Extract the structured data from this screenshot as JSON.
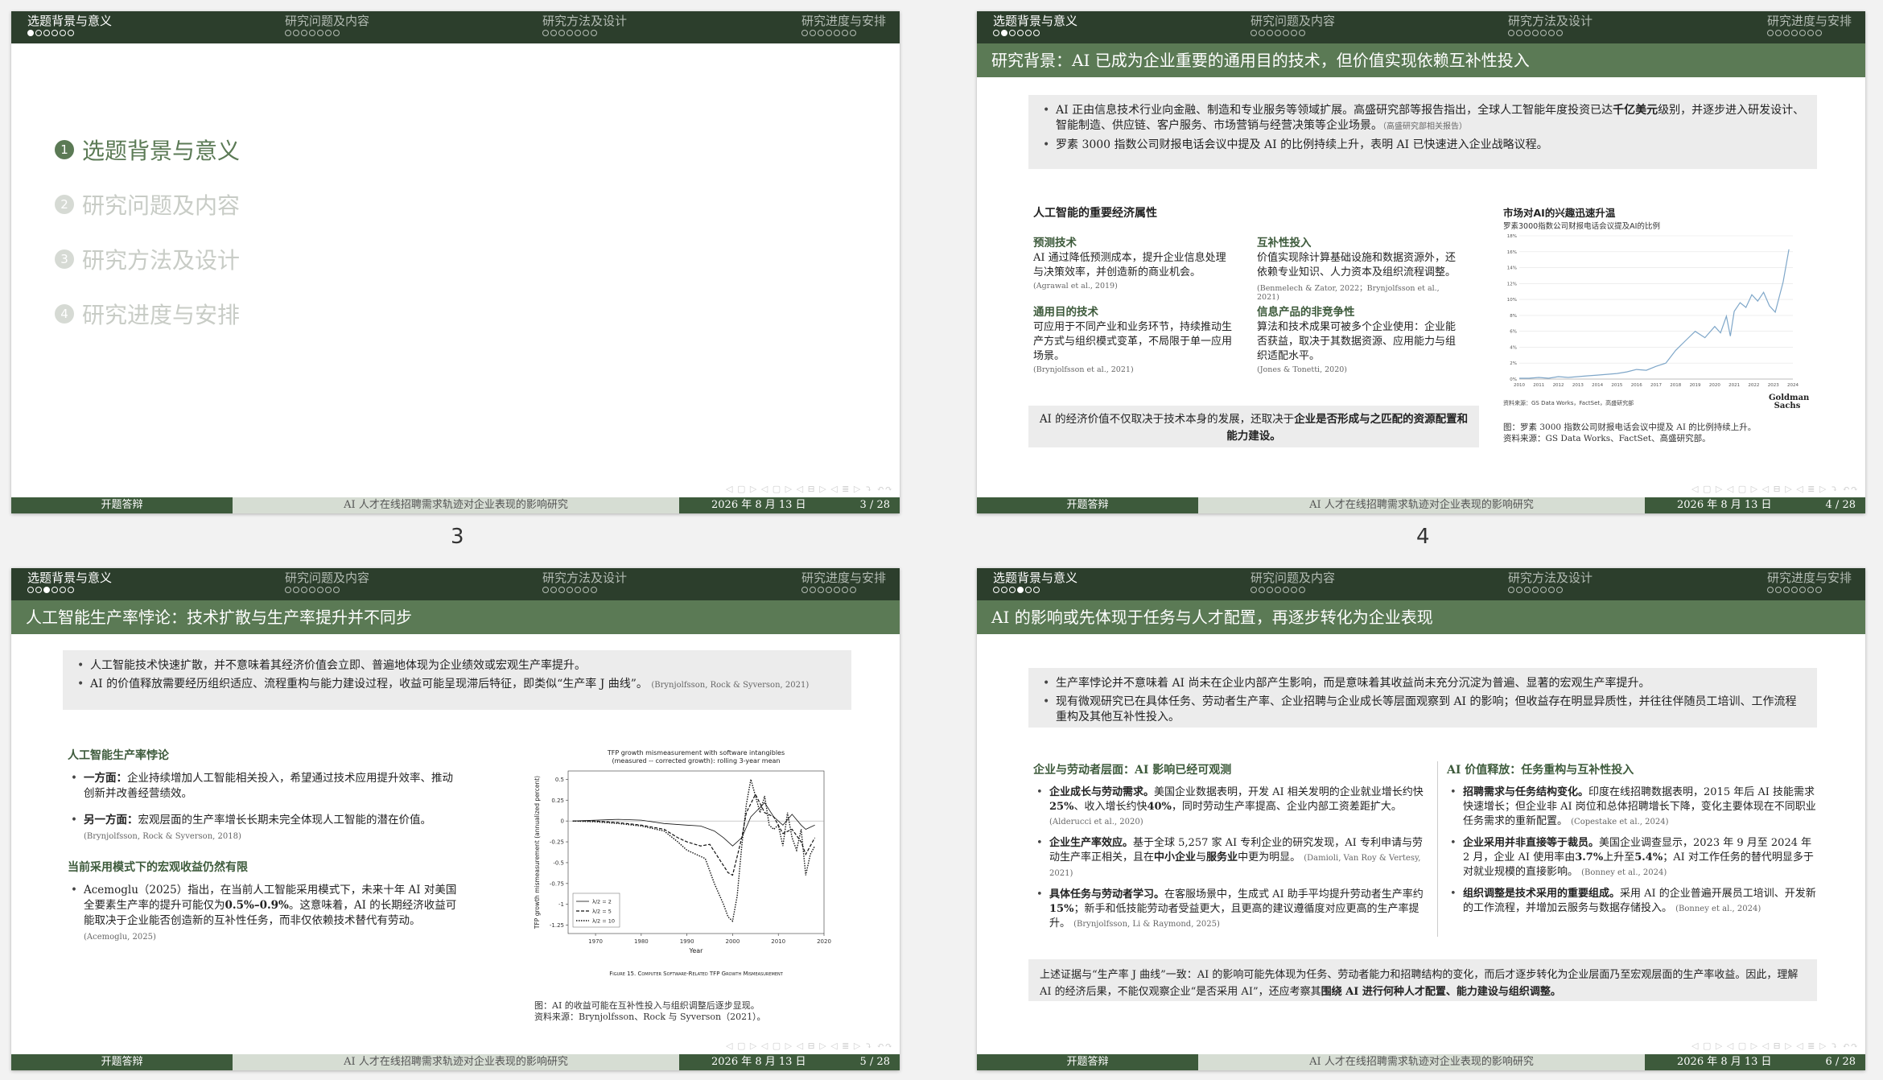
{
  "nav": [
    "选题背景与意义",
    "研究问题及内容",
    "研究方法及设计",
    "研究进度与安排"
  ],
  "footer": {
    "left": "开题答辩",
    "middle": "AI 人才在线招聘需求轨迹对企业表现的影响研究",
    "date": "2026 年 8 月 13 日"
  },
  "navsym": "◁ ▢ ▷  ◁ ▢ ▷  ◁ ⊟ ▷  ◁ ≣ ▷   ⤵   ↶↷",
  "labels": {
    "s3": "3",
    "s4": "4"
  },
  "slide3": {
    "page": "3 / 28",
    "outline": [
      {
        "num": "1",
        "text": "选题背景与意义"
      },
      {
        "num": "2",
        "text": "研究问题及内容"
      },
      {
        "num": "3",
        "text": "研究方法及设计"
      },
      {
        "num": "4",
        "text": "研究进度与安排"
      }
    ]
  },
  "slide4": {
    "page": "4 / 28",
    "title": "研究背景：AI 已成为企业重要的通用目的技术，但价值实现依赖互补性投入",
    "b1a": "AI 正由信息技术行业向金融、制造和专业服务等领域扩展。高盛研究部等报告指出，全球人工智能年度投资已达",
    "b1b": "千亿美元",
    "b1c": "级别，并逐步进入研发设计、智能制造、供应链、客户服务、市场营销与经营决策等企业场景。",
    "b1cite": "（高盛研究部相关报告）",
    "b2": "罗素 3000 指数公司财报电话会议中提及 AI 的比例持续上升，表明 AI 已快速进入企业战略议程。",
    "props_title": "人工智能的重要经济属性",
    "cells": [
      {
        "t": "预测技术",
        "b": "AI 通过降低预测成本，提升企业信息处理与决策效率，并创造新的商业机会。",
        "c": "(Agrawal et al., 2019)"
      },
      {
        "t": "互补性投入",
        "b": "价值实现除计算基础设施和数据资源外，还依赖专业知识、人力资本及组织流程调整。",
        "c": "(Benmelech & Zator, 2022；Brynjolfsson et al., 2021)"
      },
      {
        "t": "通用目的技术",
        "b": "可应用于不同产业和业务环节，持续推动生产方式与组织模式变革，不局限于单一应用场景。",
        "c": "(Brynjolfsson et al., 2021)"
      },
      {
        "t": "信息产品的非竞争性",
        "b": "算法和技术成果可被多个企业使用：企业能否获益，取决于其数据资源、应用能力与组织适配水平。",
        "c": "(Jones & Tonetti, 2020)"
      }
    ],
    "concl_a": "AI 的经济价值不仅取决于技术本身的发展，还取决于",
    "concl_b": "企业是否形成与之匹配的资源配置和能力建设。",
    "chart_title": "市场对AI的兴趣迅速升温",
    "chart_sub": "罗素3000指数公司财报电话会议提及AI的比例",
    "chart_source": "资料来源：GS Data Works，FactSet，高盛研究部",
    "gs_logo": "Goldman Sachs",
    "cap1": "图：罗素 3000 指数公司财报电话会议中提及 AI 的比例持续上升。",
    "cap2": "资料来源：GS Data Works、FactSet、高盛研究部。"
  },
  "slide5": {
    "page": "5 / 28",
    "title": "人工智能生产率悖论：技术扩散与生产率提升并不同步",
    "b1": "人工智能技术快速扩散，并不意味着其经济价值会立即、普遍地体现为企业绩效或宏观生产率提升。",
    "b2": "AI 的价值释放需要经历组织适应、流程重构与能力建设过程，收益可能呈现滞后特征，即类似“生产率 J 曲线”。",
    "b2cite": "(Brynjolfsson, Rock & Syverson, 2021)",
    "h1": "人工智能生产率悖论",
    "p1a": "一方面：",
    "p1b": "企业持续增加人工智能相关投入，希望通过技术应用提升效率、推动创新并改善经营绩效。",
    "p2a": "另一方面：",
    "p2b": "宏观层面的生产率增长长期未完全体现人工智能的潜在价值。",
    "p2cite": "(Brynjolfsson, Rock & Syverson, 2018)",
    "h2": "当前采用模式下的宏观收益仍然有限",
    "p3a": "Acemoglu（2025）指出，在当前人工智能采用模式下，未来十年 AI 对美国全要素生产率的提升可能仅为",
    "p3b": "0.5%–0.9%",
    "p3c": "。这意味着，AI 的长期经济收益可能取决于企业能否创造新的互补性任务，而非仅依赖技术替代有劳动。",
    "p3cite": "(Acemoglu, 2025)",
    "fig_title1": "TFP growth mismeasurement with software intangibles",
    "fig_title2": "(measured -- corrected growth): rolling 3-year mean",
    "fig_ylabel": "TFP growth mismeasurement (annualized percent)",
    "fig_xlabel": "Year",
    "fig_caption": "Figure 15. Computer Software-Related TFP Growth Mismeasurement",
    "legend": [
      "λ/2 = 2",
      "λ/2 = 5",
      "λ/2 = 10"
    ],
    "cap1": "图：AI 的收益可能在互补性投入与组织调整后逐步显现。",
    "cap2": "资料来源：Brynjolfsson、Rock 与 Syverson（2021）。"
  },
  "slide6": {
    "page": "6 / 28",
    "title": "AI 的影响或先体现于任务与人才配置，再逐步转化为企业表现",
    "b1": "生产率悖论并不意味着 AI 尚未在企业内部产生影响，而是意味着其收益尚未充分沉淀为普遍、显著的宏观生产率提升。",
    "b2": "现有微观研究已在具体任务、劳动者生产率、企业招聘与企业成长等层面观察到 AI 的影响；但收益存在明显异质性，并往往伴随员工培训、工作流程重构及其他互补性投入。",
    "lh": "企业与劳动者层面：AI 影响已经可观测",
    "l1a": "企业成长与劳动需求。",
    "l1b": "美国企业数据表明，开发 AI 相关发明的企业就业增长约快",
    "l1c": "25%",
    "l1d": "、收入增长约快",
    "l1e": "40%",
    "l1f": "，同时劳动生产率提高、企业内部工资差距扩大。",
    "l1cite": "(Alderucci et al., 2020)",
    "l2a": "企业生产率效应。",
    "l2b": "基于全球 5,257 家 AI 专利企业的研究发现，AI 专利申请与劳动生产率正相关，且在",
    "l2c": "中小企业",
    "l2d": "与",
    "l2e": "服务业",
    "l2f": "中更为明显。",
    "l2cite": "(Damioli, Van Roy & Vertesy, 2021)",
    "l3a": "具体任务与劳动者学习。",
    "l3b": "在客服场景中，生成式 AI 助手平均提升劳动者生产率约",
    "l3c": "15%",
    "l3d": "；新手和低技能劳动者受益更大，且更高的建议遵循度对应更高的生产率提升。",
    "l3cite": "(Brynjolfsson, Li & Raymond, 2025)",
    "rh": "AI 价值释放：任务重构与互补性投入",
    "r1a": "招聘需求与任务结构变化。",
    "r1b": "印度在线招聘数据表明，2015 年后 AI 技能需求快速增长；但企业非 AI 岗位和总体招聘增长下降，变化主要体现在不同职业任务需求的重新配置。",
    "r1cite": "(Copestake et al., 2024)",
    "r2a": "企业采用并非直接等于裁员。",
    "r2b": "美国企业调查显示，2023 年 9 月至 2024 年 2 月，企业 AI 使用率由",
    "r2c": "3.7%",
    "r2d": "上升至",
    "r2e": "5.4%",
    "r2f": "；AI 对工作任务的替代明显多于对就业规模的直接影响。",
    "r2cite": "(Bonney et al., 2024)",
    "r3a": "组织调整是技术采用的重要组成。",
    "r3b": "采用 AI 的企业普遍开展员工培训、开发新的工作流程，并增加云服务与数据存储投入。",
    "r3cite": "(Bonney et al., 2024)",
    "sum_a": "上述证据与“生产率 J 曲线”一致：AI 的影响可能先体现为任务、劳动者能力和招聘结构的变化，而后才逐步转化为企业层面乃至宏观层面的生产率收益。因此，理解 AI 的经济后果，不能仅观察企业“是否采用 AI”，还应考察其",
    "sum_b": "围绕 AI 进行何种人才配置、能力建设与组织调整。"
  },
  "chart_data": [
    {
      "type": "line",
      "title": "市场对AI的兴趣迅速升温",
      "ylabel": "",
      "x_ticks": [
        "2010",
        "2011",
        "2012",
        "2013",
        "2014",
        "2015",
        "2016",
        "2017",
        "2018",
        "2019",
        "2020",
        "2021",
        "2022",
        "2023",
        "2024"
      ],
      "y_ticks": [
        "0%",
        "2%",
        "4%",
        "6%",
        "8%",
        "10%",
        "12%",
        "14%",
        "16%",
        "18%"
      ],
      "ylim": [
        0,
        18
      ],
      "series": [
        {
          "name": "",
          "values": [
            [
              2010,
              0.1
            ],
            [
              2010.5,
              0.1
            ],
            [
              2011,
              0.2
            ],
            [
              2011.5,
              0.1
            ],
            [
              2012,
              0.3
            ],
            [
              2012.5,
              0.2
            ],
            [
              2013,
              0.3
            ],
            [
              2013.5,
              0.4
            ],
            [
              2014,
              0.5
            ],
            [
              2014.5,
              0.6
            ],
            [
              2015,
              0.7
            ],
            [
              2015.5,
              0.9
            ],
            [
              2016,
              1.2
            ],
            [
              2016.5,
              1.1
            ],
            [
              2017,
              1.6
            ],
            [
              2017.5,
              2.0
            ],
            [
              2018,
              3.6
            ],
            [
              2018.5,
              4.8
            ],
            [
              2019,
              6.0
            ],
            [
              2019.5,
              5.2
            ],
            [
              2020,
              6.6
            ],
            [
              2020.3,
              5.8
            ],
            [
              2020.6,
              7.9
            ],
            [
              2020.8,
              5.4
            ],
            [
              2021,
              8.5
            ],
            [
              2021.3,
              9.6
            ],
            [
              2021.6,
              9.0
            ],
            [
              2021.9,
              10.6
            ],
            [
              2022.2,
              9.8
            ],
            [
              2022.5,
              10.9
            ],
            [
              2022.8,
              9.2
            ],
            [
              2023.1,
              8.4
            ],
            [
              2023.5,
              12.2
            ],
            [
              2023.8,
              16.3
            ]
          ]
        }
      ]
    },
    {
      "type": "line",
      "title": "TFP growth mismeasurement with software intangibles",
      "xlabel": "Year",
      "ylabel": "TFP growth mismeasurement (annualized percent)",
      "xlim": [
        1964,
        2020
      ],
      "ylim": [
        -1.35,
        0.6
      ],
      "x_ticks": [
        "1970",
        "1980",
        "1990",
        "2000",
        "2010",
        "2020"
      ],
      "y_ticks": [
        "0.5",
        "0.25",
        "0",
        "-0.25",
        "-0.5",
        "-0.75",
        "-1",
        "-1.25"
      ],
      "series": [
        {
          "name": "λ/2 = 2",
          "values": [
            [
              1965,
              0
            ],
            [
              1970,
              0.01
            ],
            [
              1975,
              0.02
            ],
            [
              1980,
              0.01
            ],
            [
              1985,
              -0.03
            ],
            [
              1990,
              -0.05
            ],
            [
              1993,
              -0.06
            ],
            [
              1996,
              -0.12
            ],
            [
              1998,
              -0.2
            ],
            [
              2000,
              -0.3
            ],
            [
              2002,
              -0.2
            ],
            [
              2004,
              0.05
            ],
            [
              2007,
              0.22
            ],
            [
              2009,
              0.05
            ],
            [
              2011,
              -0.05
            ],
            [
              2013,
              0.08
            ],
            [
              2015,
              -0.05
            ],
            [
              2016,
              -0.1
            ],
            [
              2018,
              -0.05
            ]
          ]
        },
        {
          "name": "λ/2 = 5",
          "values": [
            [
              1965,
              0
            ],
            [
              1970,
              0
            ],
            [
              1975,
              -0.02
            ],
            [
              1980,
              -0.05
            ],
            [
              1985,
              -0.1
            ],
            [
              1988,
              -0.2
            ],
            [
              1990,
              -0.25
            ],
            [
              1993,
              -0.3
            ],
            [
              1995,
              -0.28
            ],
            [
              1997,
              -0.45
            ],
            [
              1999,
              -0.62
            ],
            [
              2000,
              -0.65
            ],
            [
              2002,
              -0.2
            ],
            [
              2003,
              0.1
            ],
            [
              2005,
              0.32
            ],
            [
              2007,
              0.1
            ],
            [
              2009,
              0.05
            ],
            [
              2011,
              -0.15
            ],
            [
              2013,
              -0.1
            ],
            [
              2015,
              -0.25
            ],
            [
              2016,
              -0.4
            ],
            [
              2018,
              -0.2
            ]
          ]
        },
        {
          "name": "λ/2 = 10",
          "values": [
            [
              1965,
              0
            ],
            [
              1970,
              -0.01
            ],
            [
              1975,
              -0.03
            ],
            [
              1980,
              -0.06
            ],
            [
              1985,
              -0.12
            ],
            [
              1988,
              -0.25
            ],
            [
              1990,
              -0.35
            ],
            [
              1992,
              -0.4
            ],
            [
              1994,
              -0.45
            ],
            [
              1996,
              -0.75
            ],
            [
              1998,
              -1.0
            ],
            [
              1999,
              -1.15
            ],
            [
              2000,
              -1.2
            ],
            [
              2001,
              -0.9
            ],
            [
              2002,
              -0.3
            ],
            [
              2003,
              0.2
            ],
            [
              2004,
              0.5
            ],
            [
              2005,
              0.3
            ],
            [
              2006,
              0.1
            ],
            [
              2007,
              0.3
            ],
            [
              2008,
              -0.05
            ],
            [
              2009,
              -0.1
            ],
            [
              2010,
              -0.05
            ],
            [
              2011,
              -0.3
            ],
            [
              2012,
              0.1
            ],
            [
              2013,
              -0.2
            ],
            [
              2014,
              -0.35
            ],
            [
              2015,
              -0.1
            ],
            [
              2016,
              -0.65
            ],
            [
              2017,
              -0.4
            ],
            [
              2018,
              -0.3
            ]
          ]
        }
      ]
    }
  ]
}
